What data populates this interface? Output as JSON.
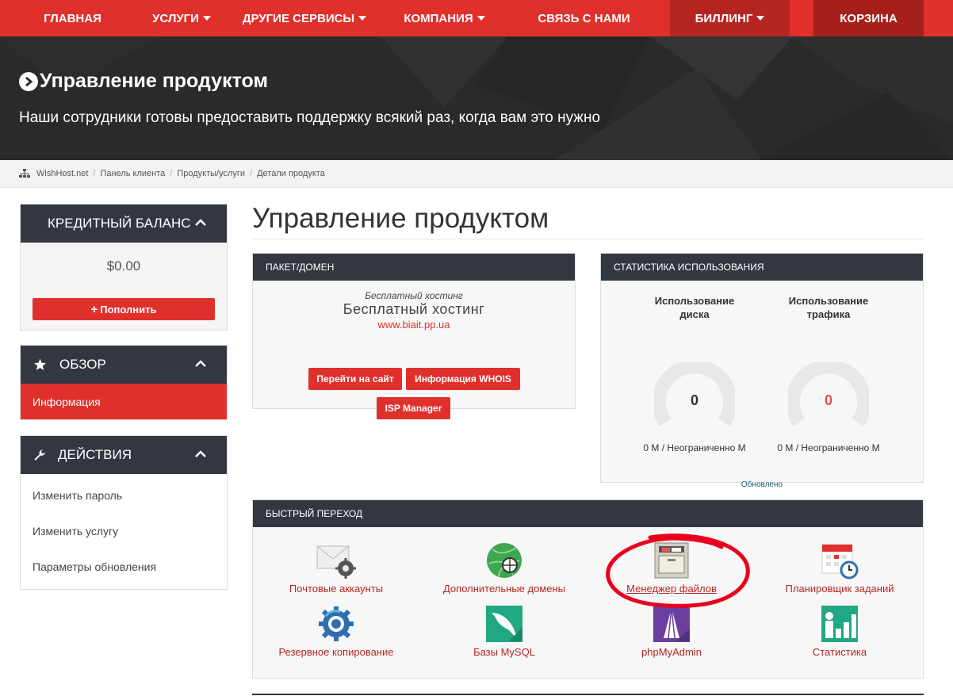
{
  "nav": {
    "items": [
      {
        "label": "Главная",
        "caret": false
      },
      {
        "label": "Услуги",
        "caret": true
      },
      {
        "label": "Другие сервисы",
        "caret": true
      },
      {
        "label": "Компания",
        "caret": true
      },
      {
        "label": "Связь с нами",
        "caret": false
      },
      {
        "label": "Биллинг",
        "caret": true
      },
      {
        "label": "Корзина",
        "caret": false
      }
    ]
  },
  "hero": {
    "title": "Управление продуктом",
    "subtitle": "Наши сотрудники готовы предоставить поддержку всякий раз, когда вам это нужно"
  },
  "breadcrumb": [
    "WishHost.net",
    "Панель клиента",
    "Продукты/услуги",
    "Детали продукта"
  ],
  "sidebar": {
    "balance": {
      "title": "Кредитный баланс",
      "amount": "$0.00",
      "button": "Пополнить"
    },
    "overview": {
      "title": "Обзор",
      "items": [
        "Информация"
      ]
    },
    "actions": {
      "title": "Действия",
      "items": [
        "Изменить пароль",
        "Изменить услугу",
        "Параметры обновления"
      ]
    }
  },
  "main": {
    "title": "Управление продуктом",
    "package": {
      "header": "Пакет/Домен",
      "italic": "Бесплатный хостинг",
      "name": "Бесплатный хостинг",
      "domain": "www.biait.pp.ua",
      "buttons": [
        "Перейти на сайт",
        "Информация WHOIS",
        "ISP Manager"
      ]
    },
    "usage": {
      "header": "Статистика использования",
      "disk": {
        "title": "Использование диска",
        "value": "0",
        "caption": "0 M / Неограниченно M"
      },
      "traffic": {
        "title": "Использование трафика",
        "value": "0",
        "caption": "0 M / Неограниченно M"
      },
      "updated": "Обновлено"
    },
    "quicklinks": {
      "header": "Быстрый переход",
      "items": [
        {
          "label": "Почтовые аккаунты",
          "icon": "mail-gear-icon"
        },
        {
          "label": "Дополнительные домены",
          "icon": "globe-icon"
        },
        {
          "label": "Менеджер файлов",
          "icon": "file-cabinet-icon"
        },
        {
          "label": "Планировщик заданий",
          "icon": "calendar-clock-icon"
        },
        {
          "label": "Резервное копирование",
          "icon": "backup-gear-icon"
        },
        {
          "label": "Базы MySQL",
          "icon": "mysql-dolphin-icon"
        },
        {
          "label": "phpMyAdmin",
          "icon": "phpmyadmin-sail-icon"
        },
        {
          "label": "Статистика",
          "icon": "statistics-chart-icon"
        }
      ]
    }
  },
  "colors": {
    "accent": "#e0302c",
    "accent_dark": "#b52623",
    "panel_head": "#333840",
    "link": "#b52623",
    "annotation": "#e8001c"
  }
}
